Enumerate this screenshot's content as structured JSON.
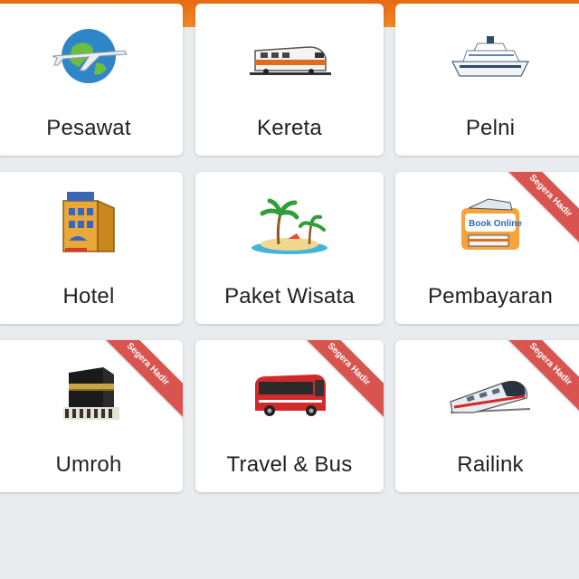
{
  "header": {
    "accent_color": "#f08a24"
  },
  "menu": {
    "items": [
      {
        "label": "Pesawat",
        "icon": "airplane-globe-icon"
      },
      {
        "label": "Kereta",
        "icon": "train-icon"
      },
      {
        "label": "Pelni",
        "icon": "cruise-ship-icon"
      },
      {
        "label": "Hotel",
        "icon": "hotel-building-icon"
      },
      {
        "label": "Paket Wisata",
        "icon": "palm-island-icon"
      },
      {
        "label": "Pembayaran",
        "icon": "book-online-icon",
        "ribbon": "Segera Hadir"
      },
      {
        "label": "Umroh",
        "icon": "kaaba-icon",
        "ribbon": "Segera Hadir"
      },
      {
        "label": "Travel & Bus",
        "icon": "bus-icon",
        "ribbon": "Segera Hadir"
      },
      {
        "label": "Railink",
        "icon": "railink-train-icon",
        "ribbon": "Segera Hadir"
      }
    ]
  },
  "ribbon_color": "#d9534f"
}
